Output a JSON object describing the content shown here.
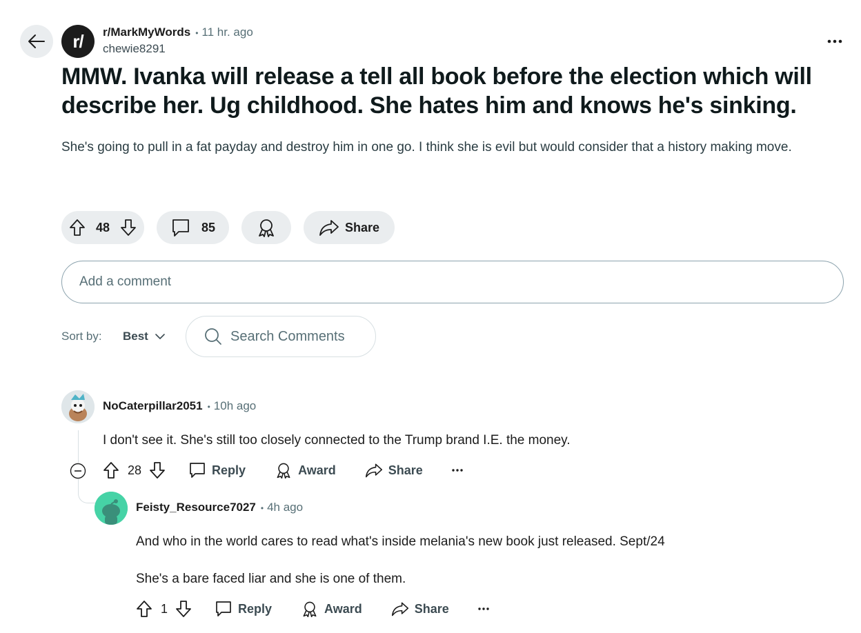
{
  "post": {
    "subreddit": "r/MarkMyWords",
    "subreddit_icon_text": "r/",
    "time": "11 hr. ago",
    "author": "chewie8291",
    "title": "MMW. Ivanka will release a tell all book before the election which will describe her. Ug childhood. She hates him and knows he's sinking.",
    "body": "She's going to pull in a fat payday and destroy him in one go. I think she is evil but would consider that a history making move.",
    "votes": "48",
    "comments_count": "85",
    "share_label": "Share"
  },
  "add_comment": {
    "placeholder": "Add a comment"
  },
  "sort": {
    "label": "Sort by:",
    "value": "Best"
  },
  "search_comments": {
    "placeholder": "Search Comments"
  },
  "comments": [
    {
      "user": "NoCaterpillar2051",
      "time": "10h ago",
      "body": "I don't see it. She's still too closely connected to the Trump brand I.E. the money.",
      "votes": "28",
      "reply_label": "Reply",
      "award_label": "Award",
      "share_label": "Share"
    },
    {
      "user": "Feisty_Resource7027",
      "time": "4h ago",
      "body_line1": "And who in the world cares to read what's inside melania's new book just released. Sept/24",
      "body_line2": "She's a bare faced liar and she is one of them.",
      "votes": "1",
      "reply_label": "Reply",
      "award_label": "Award",
      "share_label": "Share"
    }
  ],
  "icons": {
    "back": "arrow-left-icon",
    "more": "ellipsis-icon",
    "upvote": "arrow-up-icon",
    "downvote": "arrow-down-icon",
    "comment": "speech-bubble-icon",
    "award": "award-ribbon-icon",
    "share": "share-arrow-icon",
    "search": "search-icon",
    "chevron": "chevron-down-icon",
    "collapse": "minus-circle-icon"
  },
  "colors": {
    "pill_bg": "#eaedef",
    "meta_text": "#576f76",
    "avatar2_bg": "#46d3a6"
  }
}
